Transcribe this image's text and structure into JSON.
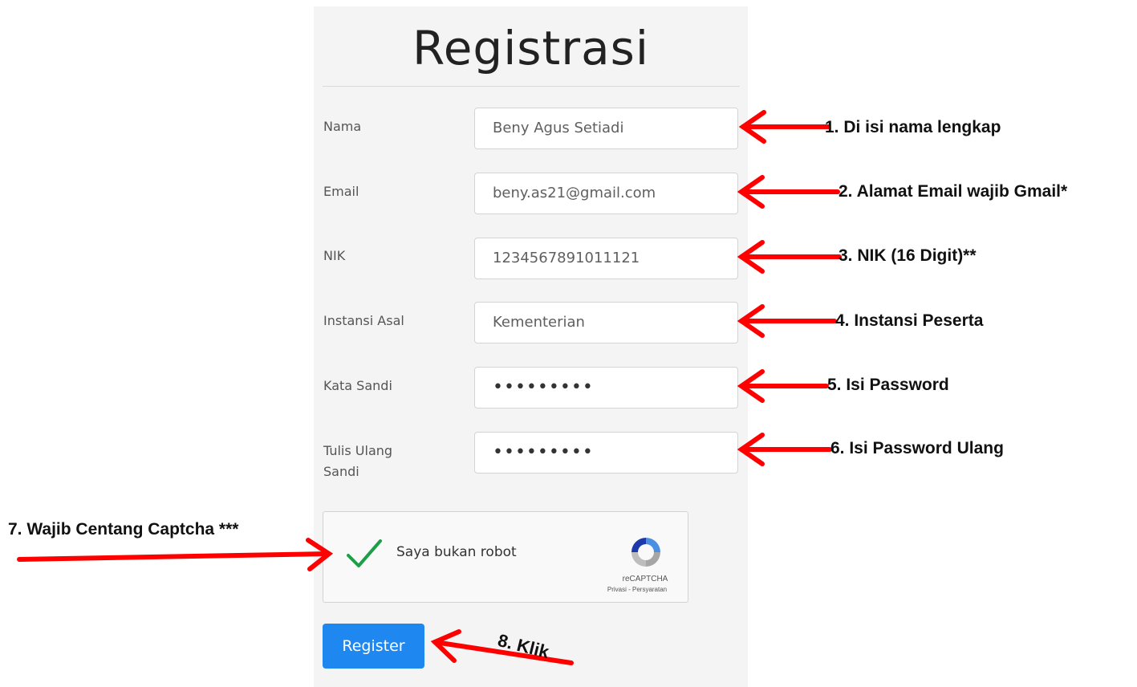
{
  "form": {
    "title": "Registrasi",
    "fields": [
      {
        "label": "Nama",
        "value": "Beny Agus Setiadi"
      },
      {
        "label": "Email",
        "value": "beny.as21@gmail.com"
      },
      {
        "label": "NIK",
        "value": "1234567891011121"
      },
      {
        "label": "Instansi Asal",
        "value": "Kementerian"
      },
      {
        "label": "Kata Sandi",
        "value": "•••••••••"
      },
      {
        "label": "Tulis Ulang Sandi",
        "value": "•••••••••"
      }
    ],
    "captcha": {
      "label": "Saya bukan robot",
      "brand": "reCAPTCHA",
      "terms": "Privasi - Persyaratan",
      "checked": true
    },
    "register_button": "Register"
  },
  "annotations": {
    "step1": "1. Di isi nama lengkap",
    "step2": "2. Alamat Email wajib Gmail*",
    "step3": "3. NIK (16 Digit)**",
    "step4": "4.  Instansi Peserta",
    "step5": "5. Isi Password",
    "step6": "6. Isi Password Ulang",
    "step7": "7. Wajib Centang Captcha ***",
    "step8": "8. Klik"
  },
  "colors": {
    "arrow": "#ff0000",
    "button": "#1e87f0",
    "check": "#1e9e4a",
    "panel": "#f4f4f4"
  }
}
